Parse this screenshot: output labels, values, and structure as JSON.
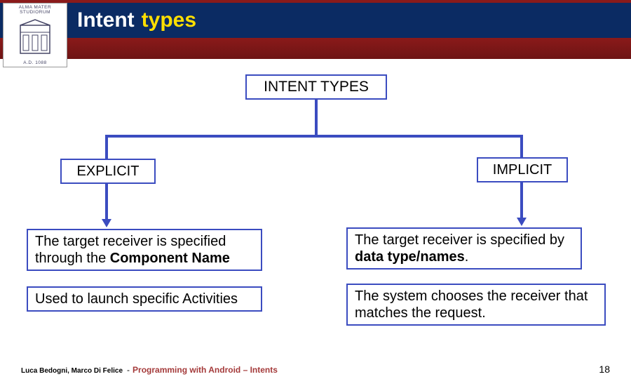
{
  "header": {
    "title_part1": "Intent",
    "title_part2": "types",
    "logo": {
      "top_text": "ALMA MATER STUDIORUM",
      "bottom_text": "A.D. 1088"
    }
  },
  "diagram": {
    "root": "INTENT TYPES",
    "left": {
      "label": "EXPLICIT",
      "desc_pre": "The target receiver is specified through the ",
      "desc_bold": "Component Name",
      "note": "Used to launch specific Activities"
    },
    "right": {
      "label": "IMPLICIT",
      "desc_pre": "The target receiver is specified by ",
      "desc_bold": "data type/names",
      "desc_post": ".",
      "note": "The system chooses the receiver that matches the request."
    }
  },
  "footer": {
    "authors": "Luca Bedogni, Marco Di Felice",
    "sep": "-",
    "course": "Programming with Android – Intents",
    "page": "18"
  }
}
